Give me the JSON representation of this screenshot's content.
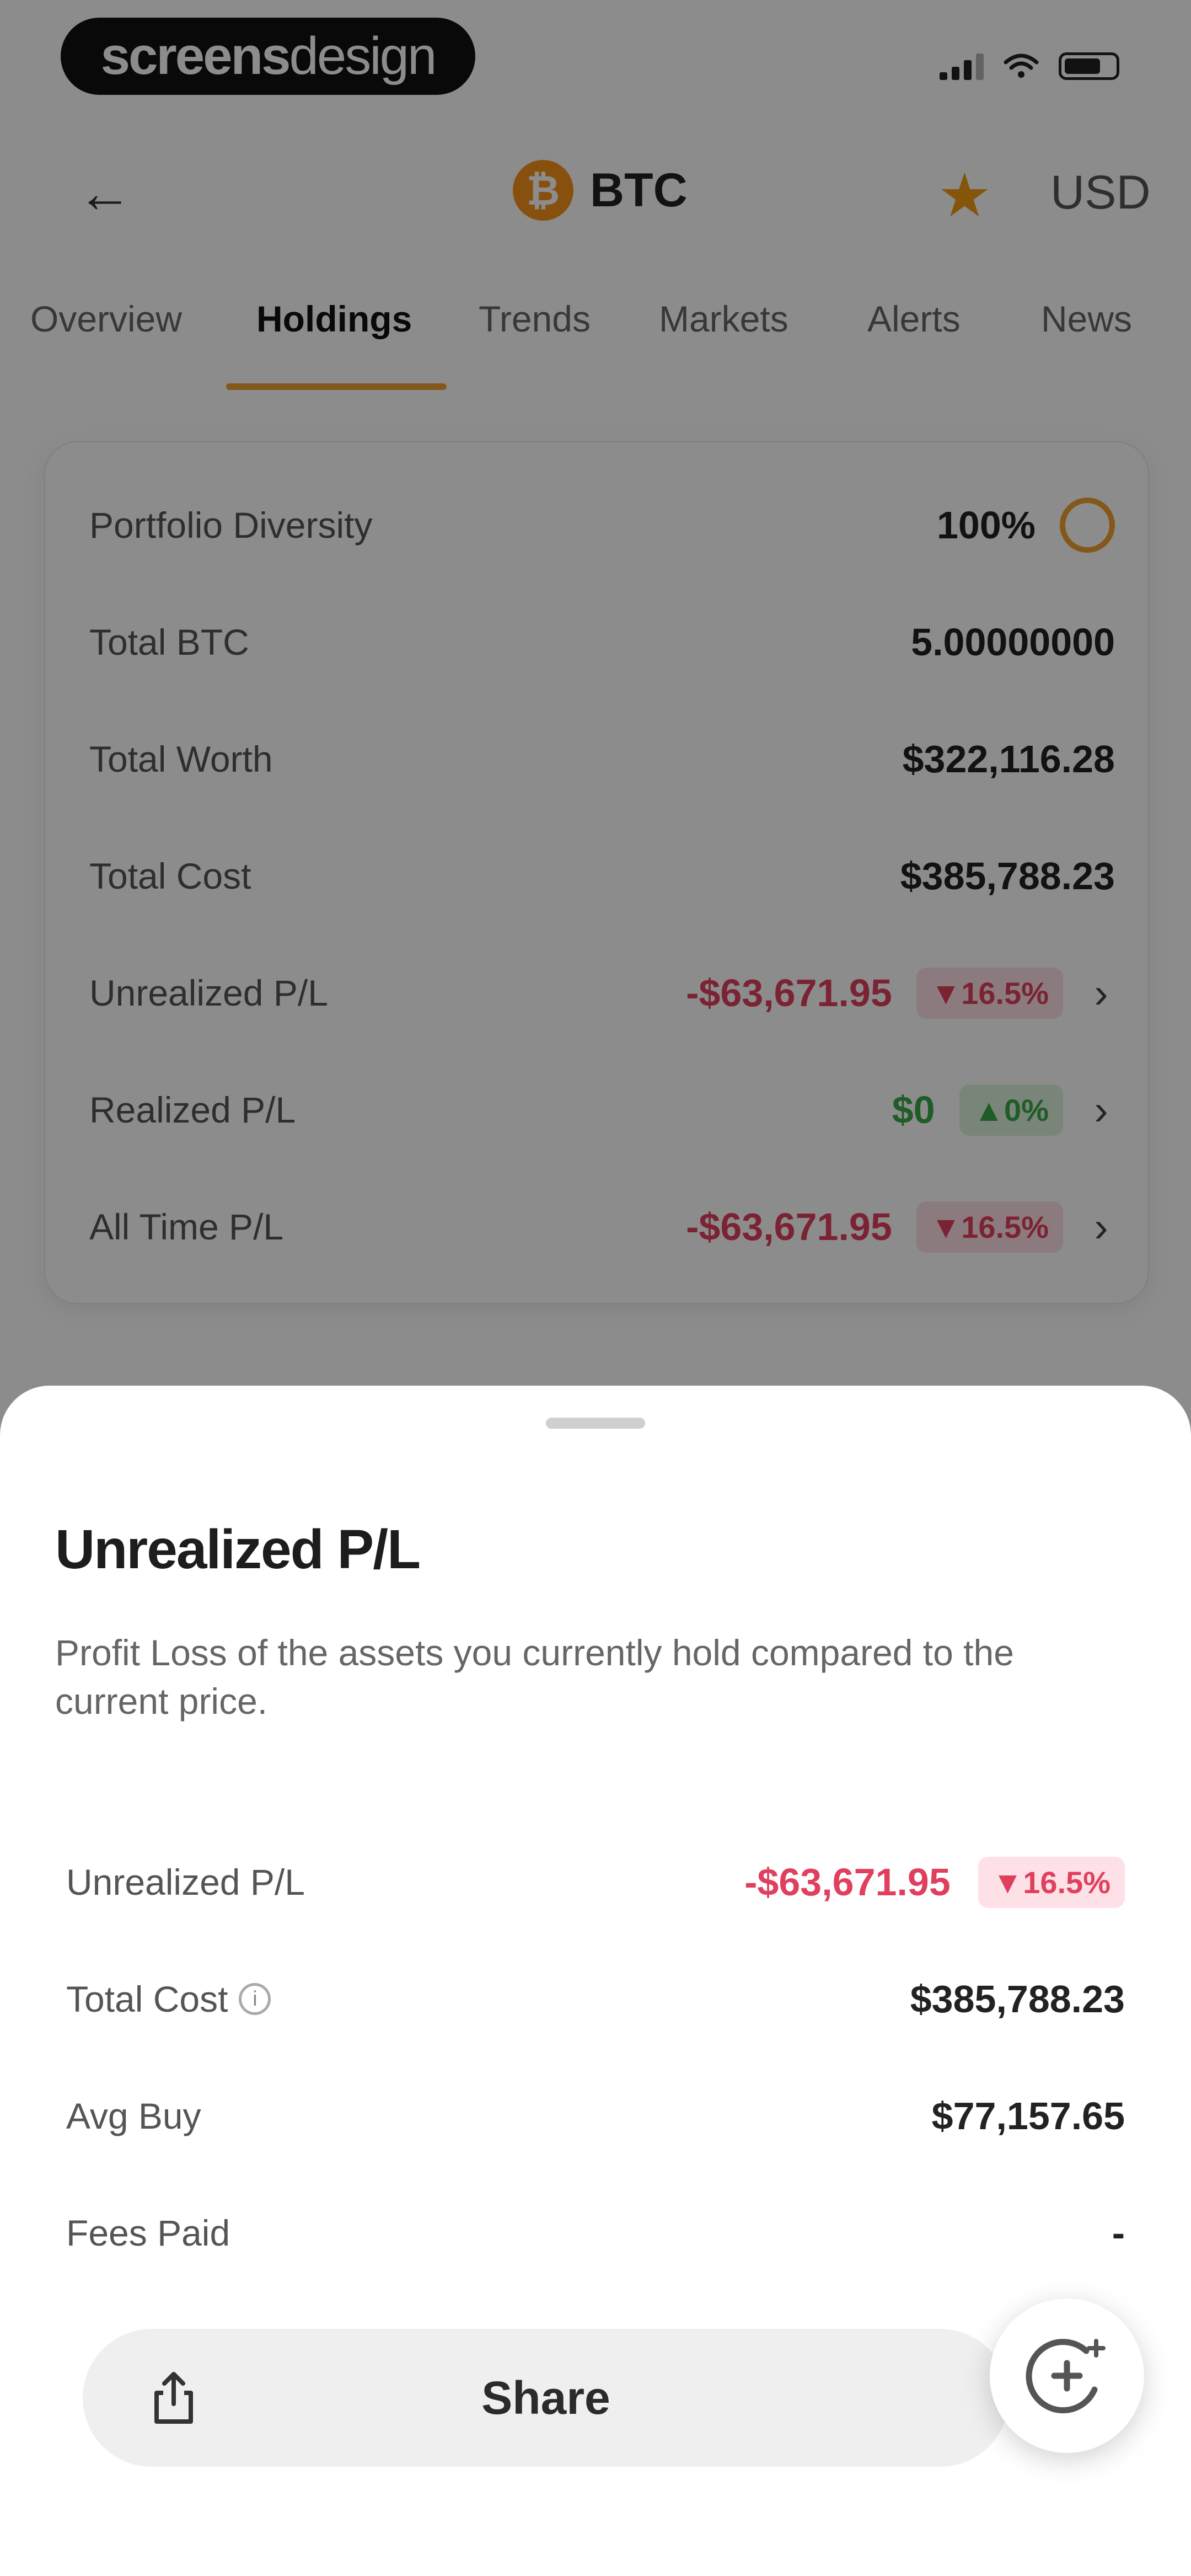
{
  "status_bar": {
    "brand_bold": "screens",
    "brand_light": "design"
  },
  "nav": {
    "back_icon": "arrow-left-icon",
    "coin_symbol_glyph": "₿",
    "coin_name": "BTC",
    "favorite_icon": "star-icon",
    "currency": "USD"
  },
  "tabs": [
    {
      "label": "Overview",
      "active": false
    },
    {
      "label": "Holdings",
      "active": true
    },
    {
      "label": "Trends",
      "active": false
    },
    {
      "label": "Markets",
      "active": false
    },
    {
      "label": "Alerts",
      "active": false
    },
    {
      "label": "News",
      "active": false
    }
  ],
  "holdings": {
    "portfolio_diversity": {
      "label": "Portfolio Diversity",
      "value": "100%"
    },
    "total_btc": {
      "label": "Total BTC",
      "value": "5.00000000"
    },
    "total_worth": {
      "label": "Total Worth",
      "value": "$322,116.28"
    },
    "total_cost": {
      "label": "Total Cost",
      "value": "$385,788.23"
    },
    "unrealized_pl": {
      "label": "Unrealized P/L",
      "value": "-$63,671.95",
      "change": "▼16.5%"
    },
    "realized_pl": {
      "label": "Realized P/L",
      "value": "$0",
      "change": "▲0%"
    },
    "all_time_pl": {
      "label": "All Time P/L",
      "value": "-$63,671.95",
      "change": "▼16.5%"
    }
  },
  "sheet": {
    "title": "Unrealized P/L",
    "description": "Profit Loss of the assets you currently hold compared to the current price.",
    "rows": {
      "unrealized_pl": {
        "label": "Unrealized P/L",
        "value": "-$63,671.95",
        "change": "▼16.5%"
      },
      "total_cost": {
        "label": "Total Cost",
        "value": "$385,788.23"
      },
      "avg_buy": {
        "label": "Avg Buy",
        "value": "$77,157.65"
      },
      "fees_paid": {
        "label": "Fees Paid",
        "value": "-"
      }
    },
    "share_label": "Share"
  },
  "colors": {
    "accent": "#f0a030",
    "negative": "#e0405e",
    "positive": "#3aa84a",
    "bitcoin": "#f7931a"
  }
}
